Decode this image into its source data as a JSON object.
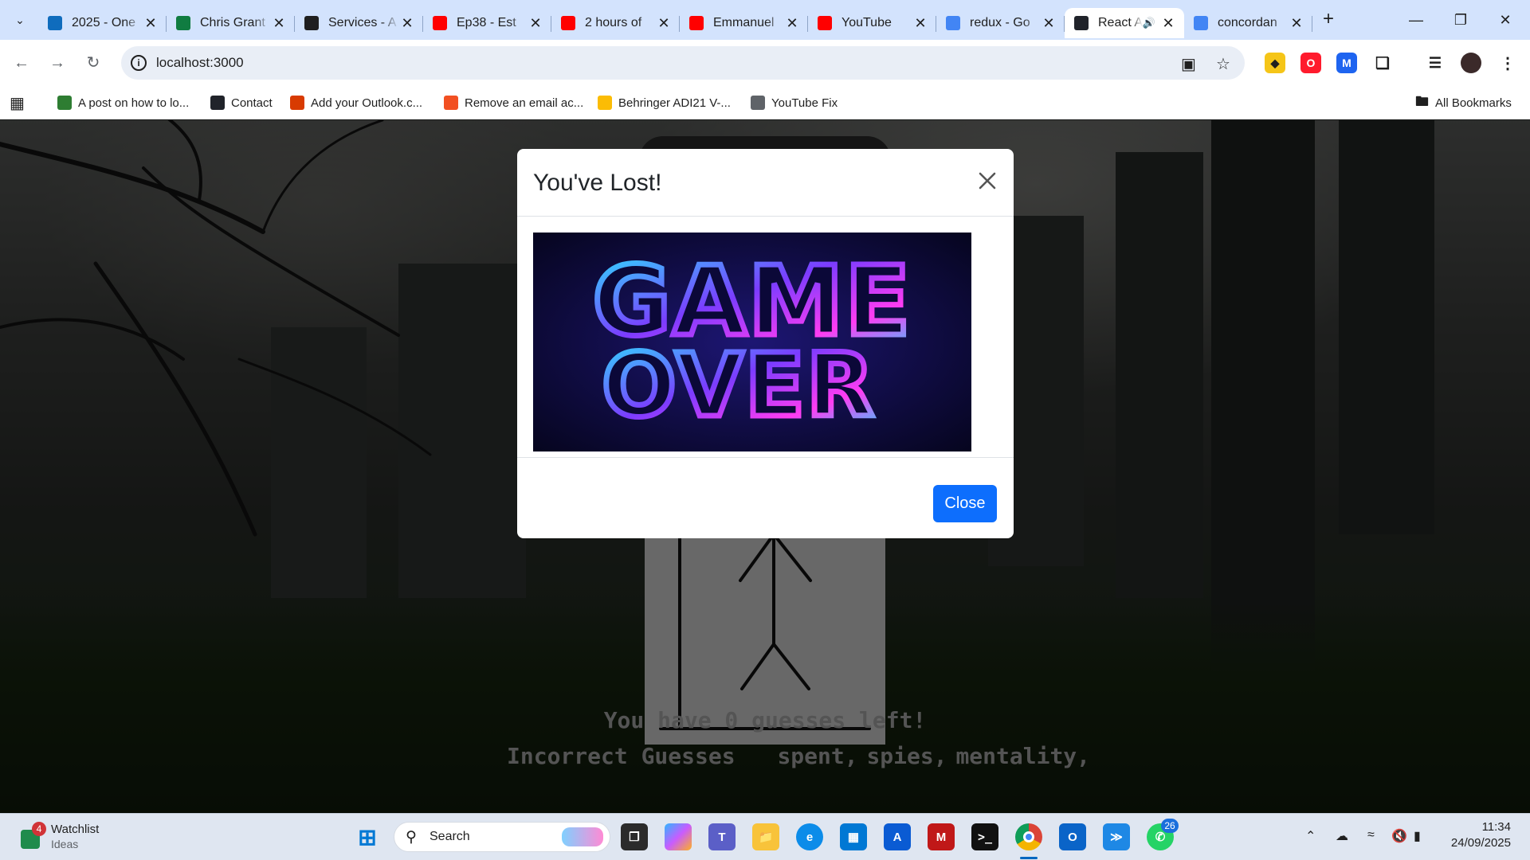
{
  "browser": {
    "tabs": [
      {
        "title": "2025 - One",
        "favicon": "onedrive-icon",
        "color": "#0f6cbd"
      },
      {
        "title": "Chris Grant",
        "favicon": "excel-icon",
        "color": "#107c41"
      },
      {
        "title": "Services - A",
        "favicon": "menu-icon",
        "color": "#1f1f1f"
      },
      {
        "title": "Ep38 - Est",
        "favicon": "youtube-icon",
        "color": "#ff0000"
      },
      {
        "title": "2 hours of",
        "favicon": "youtube-icon",
        "color": "#ff0000"
      },
      {
        "title": "Emmanuel",
        "favicon": "youtube-icon",
        "color": "#ff0000"
      },
      {
        "title": "YouTube",
        "favicon": "youtube-icon",
        "color": "#ff0000"
      },
      {
        "title": "redux - Go",
        "favicon": "google-icon",
        "color": "#4285f4"
      },
      {
        "title": "React A",
        "favicon": "react-icon",
        "color": "#20232a",
        "active": true
      },
      {
        "title": "concordan",
        "favicon": "google-icon",
        "color": "#4285f4"
      }
    ],
    "url": "localhost:3000",
    "bookmarks": [
      {
        "label": "A post on how to lo...",
        "favicon": "site-icon",
        "color": "#2e7d32"
      },
      {
        "label": "Contact",
        "favicon": "react-icon",
        "color": "#20232a"
      },
      {
        "label": "Add your Outlook.c...",
        "favicon": "office-icon",
        "color": "#d83b01"
      },
      {
        "label": "Remove an email ac...",
        "favicon": "microsoft-icon",
        "color": "#f25022"
      },
      {
        "label": "Behringer ADI21 V-...",
        "favicon": "google-icon",
        "color": "#fbbc05"
      },
      {
        "label": "YouTube Fix",
        "favicon": "globe-icon",
        "color": "#5f6368"
      }
    ],
    "all_bookmarks_label": "All Bookmarks"
  },
  "modal": {
    "title": "You've Lost!",
    "image_text_line1": "GAME",
    "image_text_line2": "OVER",
    "close_button": "Close"
  },
  "game": {
    "guesses_left_text": "You have 0 guesses left!",
    "incorrect_label": "Incorrect Guesses",
    "incorrect_words": "spent,  spies,  mentality,"
  },
  "taskbar": {
    "widget_title": "Watchlist",
    "widget_subtitle": "Ideas",
    "widget_badge": "4",
    "search_label": "Search",
    "whatsapp_badge": "26",
    "time": "11:34",
    "date": "24/09/2025"
  },
  "colors": {
    "tabstrip": "#d3e3fd",
    "modal_primary": "#0d6efd",
    "guess_text": "#a8a8a8"
  }
}
